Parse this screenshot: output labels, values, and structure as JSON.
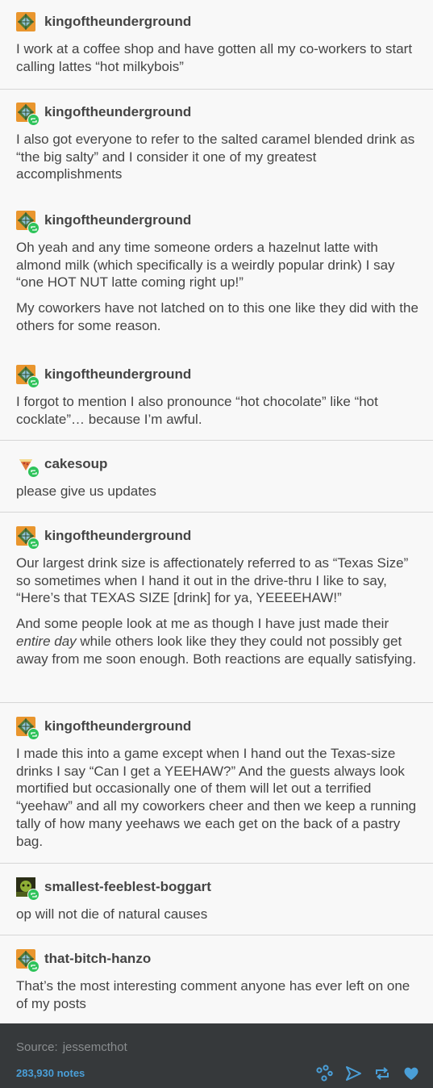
{
  "posts": [
    {
      "username": "kingoftheunderground",
      "avatar": "kingoftheunderground-avatar",
      "paragraphs": [
        "I work at a coffee shop and have gotten all my co-workers to start calling lattes “hot milkybois”"
      ]
    },
    {
      "username": "kingoftheunderground",
      "avatar": "kingoftheunderground-avatar",
      "paragraphs": [
        "I also got everyone to refer to the salted caramel blended drink as “the big salty” and I consider it one of my greatest accomplishments"
      ]
    },
    {
      "username": "kingoftheunderground",
      "avatar": "kingoftheunderground-avatar",
      "paragraphs": [
        "Oh yeah and any time someone orders a hazelnut latte with almond milk (which specifically is a weirdly popular drink) I say “one HOT NUT latte coming right up!”",
        "My coworkers have not latched on to this one like they did with the others for some reason."
      ]
    },
    {
      "username": "kingoftheunderground",
      "avatar": "kingoftheunderground-avatar",
      "paragraphs": [
        "I forgot to mention I also pronounce “hot chocolate” like “hot cocklate”… because I’m awful."
      ]
    },
    {
      "username": "cakesoup",
      "avatar": "cakesoup-avatar",
      "paragraphs": [
        "please give us updates"
      ]
    },
    {
      "username": "kingoftheunderground",
      "avatar": "kingoftheunderground-avatar",
      "paragraphs": [
        "Our largest drink size is affectionately referred to as “Texas Size” so sometimes when I hand it out in the drive-thru I like to say, “Here’s that TEXAS SIZE [drink] for ya, YEEEEHAW!”",
        "And some people look at me as though I have just made their <em>entire day</em> while others look like they they could not possibly get away from me soon enough. Both reactions are equally satisfying."
      ]
    },
    {
      "username": "kingoftheunderground",
      "avatar": "kingoftheunderground-avatar",
      "paragraphs": [
        "I made this into a game except when I hand out the Texas-size drinks I say “Can I get a YEEHAW?” And the guests always look mortified but occasionally one of them will let out a terrified “yeehaw” and all my coworkers cheer and then we keep a running tally of how many yeehaws we each get on the back of a pastry bag."
      ]
    },
    {
      "username": "smallest-feeblest-boggart",
      "avatar": "smallest-feeblest-boggart-avatar",
      "paragraphs": [
        "op will not die of natural causes"
      ]
    },
    {
      "username": "that-bitch-hanzo",
      "avatar": "that-bitch-hanzo-avatar",
      "paragraphs": [
        "That’s the most interesting comment anyone has ever left on one of my posts"
      ]
    }
  ],
  "footer": {
    "source_label": "Source:",
    "source_value": "jessemcthot",
    "notes": "283,930 notes",
    "icons": [
      "share-icon",
      "send-icon",
      "reblog-icon",
      "heart-icon"
    ],
    "accent": "#4a9fd8",
    "background": "#36393b"
  },
  "colors": {
    "reblog_badge": "#2ec35a",
    "text": "#444444",
    "page_background": "#f8f8f8"
  }
}
